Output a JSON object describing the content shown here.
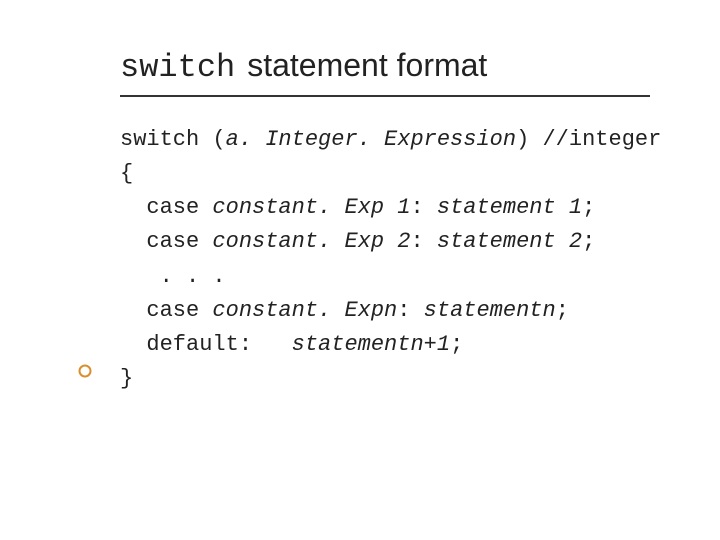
{
  "title": {
    "code": "switch",
    "rest": "statement format"
  },
  "code": {
    "l1a": "switch (",
    "l1b": "a. Integer. Expression",
    "l1c": ") //integer",
    "l2": "{",
    "l3a": "  case ",
    "l3b": "constant. Exp 1",
    "l3c": ": ",
    "l3d": "statement 1",
    "l3e": ";",
    "l4a": "  case ",
    "l4b": "constant. Exp 2",
    "l4c": ": ",
    "l4d": "statement 2",
    "l4e": ";",
    "l5": "   . . .",
    "l6a": "  case ",
    "l6b": "constant. Expn",
    "l6c": ": ",
    "l6d": "statementn",
    "l6e": ";",
    "l7a": "  default:   ",
    "l7b": "statementn+1",
    "l7c": ";",
    "l8": "}"
  }
}
